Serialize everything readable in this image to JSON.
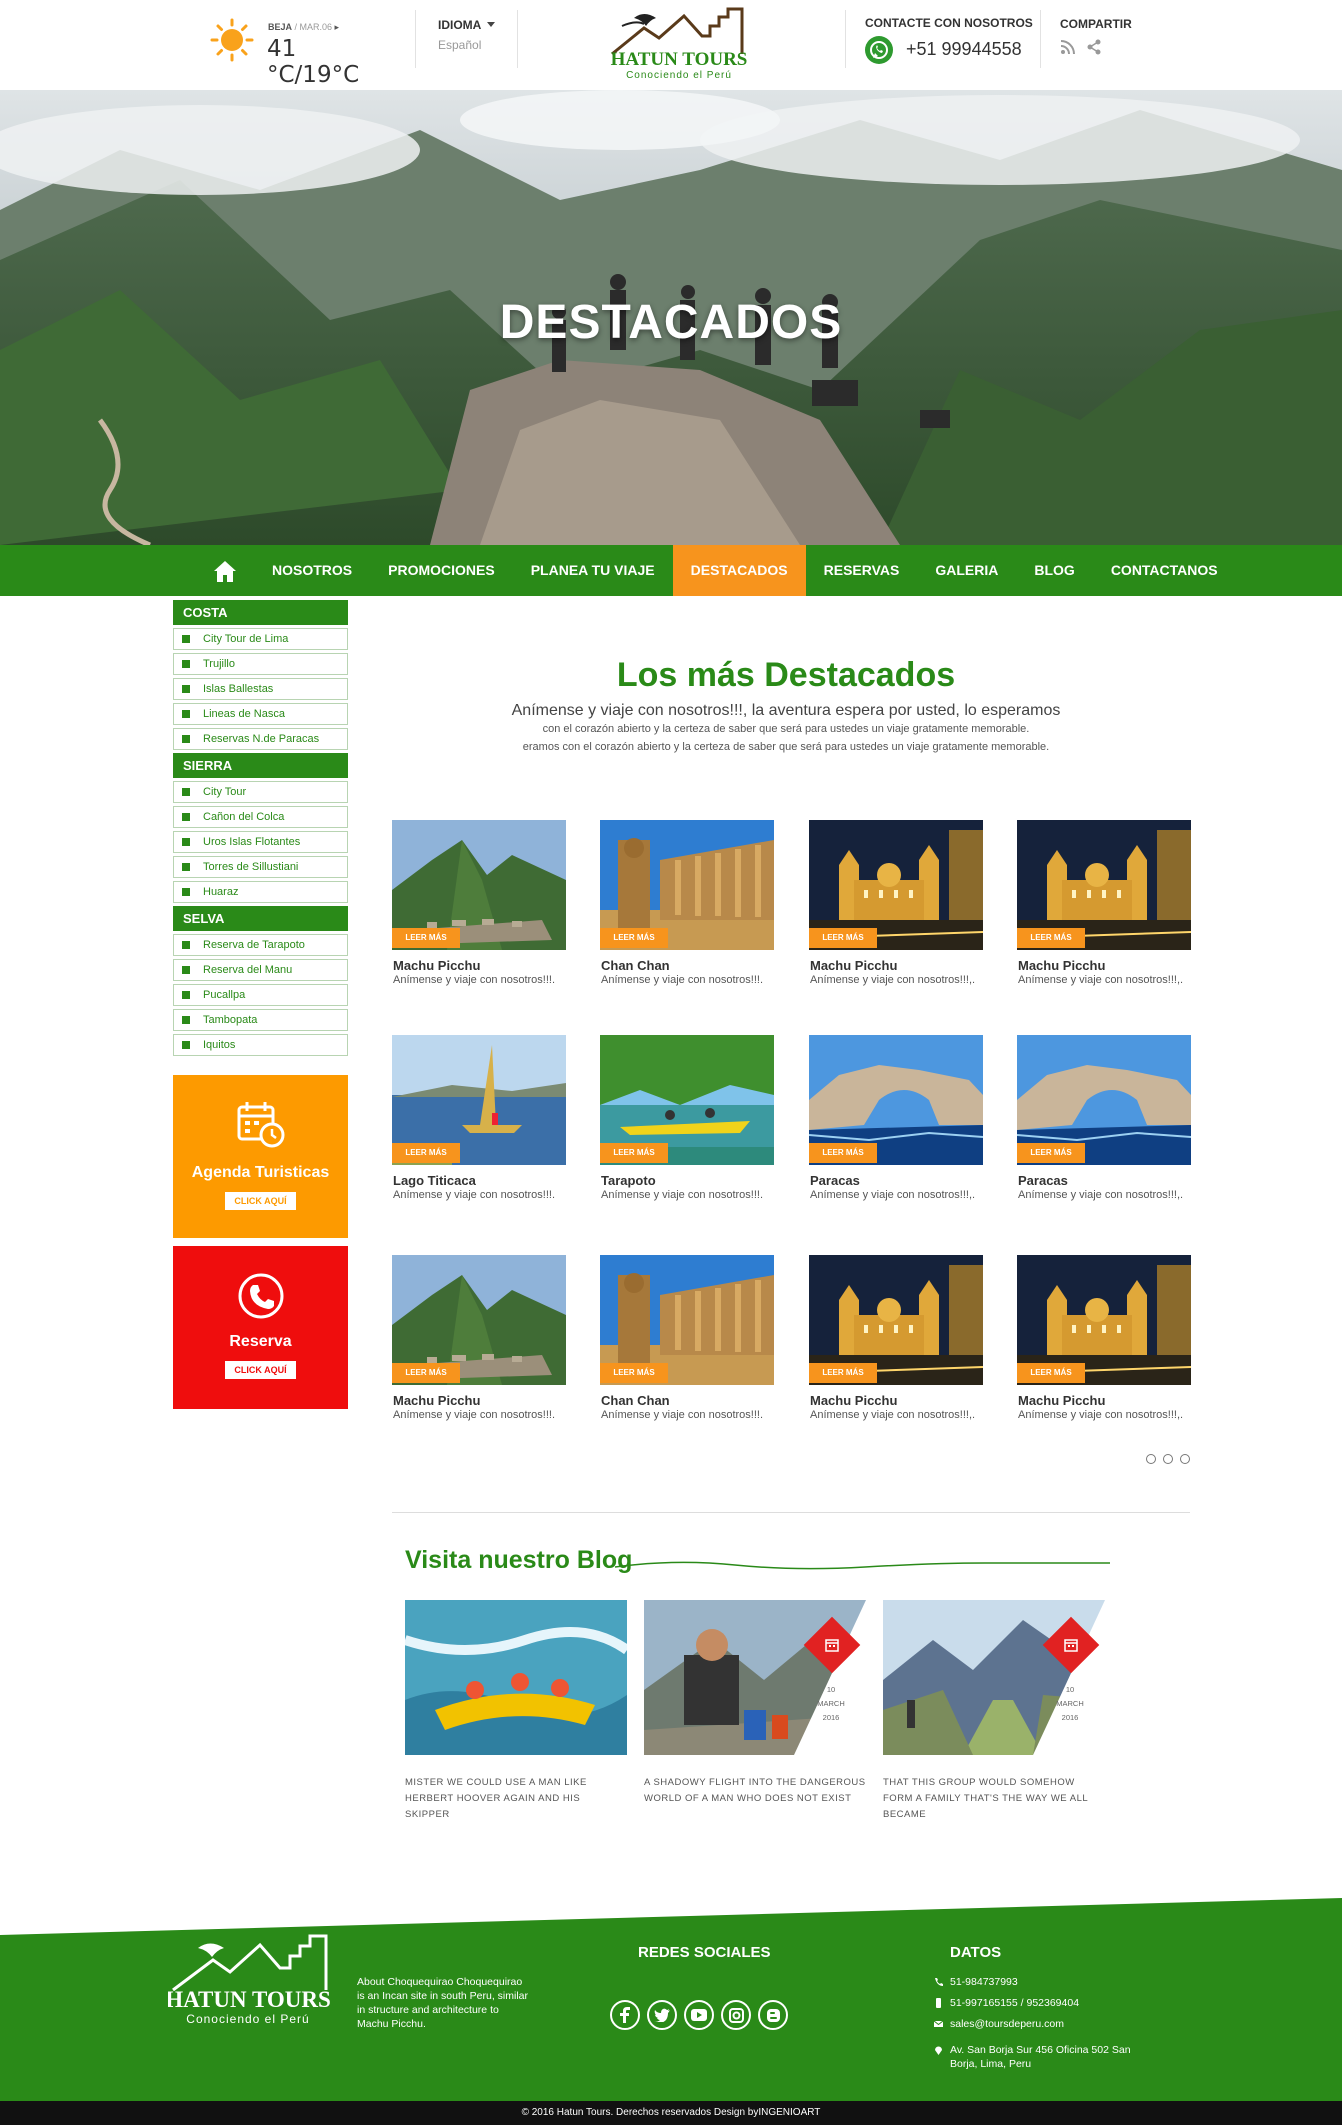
{
  "topbar": {
    "weather": {
      "location": "BEJA",
      "date": "/ MAR.06",
      "temp": "41 °C/19°C",
      "icon": "sun-icon"
    },
    "language": {
      "label": "IDIOMA",
      "value": "Español"
    },
    "logo": {
      "name": "HATUN TOURS",
      "tagline": "Conociendo el Perú"
    },
    "contact": {
      "label": "CONTACTE CON NOSOTROS",
      "phone": "+51 99944558",
      "icon": "whatsapp-icon"
    },
    "share": {
      "label": "COMPARTIR",
      "icons": [
        "rss-icon",
        "share-icon"
      ]
    }
  },
  "hero": {
    "title": "DESTACADOS"
  },
  "nav": {
    "home_icon": "home-icon",
    "items": [
      {
        "label": "NOSOTROS"
      },
      {
        "label": "PROMOCIONES"
      },
      {
        "label": "PLANEA TU VIAJE"
      },
      {
        "label": "DESTACADOS"
      },
      {
        "label": "RESERVAS"
      },
      {
        "label": "GALERIA"
      },
      {
        "label": "BLOG"
      },
      {
        "label": "CONTACTANOS"
      }
    ],
    "active": "DESTACADOS"
  },
  "sidebar": {
    "categories": [
      {
        "title": "COSTA",
        "items": [
          "City Tour de Lima",
          "Trujillo",
          "Islas Ballestas",
          "Lineas de Nasca",
          "Reservas N.de Paracas"
        ]
      },
      {
        "title": "SIERRA",
        "items": [
          "City Tour",
          "Cañon del Colca",
          "Uros Islas Flotantes",
          "Torres de Sillustiani",
          "Huaraz"
        ]
      },
      {
        "title": "SELVA",
        "items": [
          "Reserva de Tarapoto",
          "Reserva del Manu",
          "Pucallpa",
          "Tambopata",
          "Iquitos"
        ]
      }
    ],
    "agenda": {
      "title": "Agenda Turisticas",
      "button": "CLICK AQUÍ",
      "icon": "calendar-clock-icon"
    },
    "reserva": {
      "title": "Reserva",
      "button": "CLICK AQUÍ",
      "icon": "phone-icon"
    }
  },
  "main": {
    "title": "Los más Destacados",
    "intro": "Anímense y viaje con nosotros!!!, la aventura espera por usted, lo esperamos",
    "sub1": "con el corazón abierto y la certeza de saber que será para ustedes un viaje gratamente memorable.",
    "sub2": "eramos con el corazón abierto y la certeza de saber que será para ustedes un viaje gratamente memorable.",
    "read_more": "LEER MÁS",
    "cards": [
      {
        "title": "Machu Picchu",
        "desc": "Anímense y viaje con nosotros!!!.",
        "scene": "machu"
      },
      {
        "title": "Chan Chan",
        "desc": "Anímense y viaje con nosotros!!!.",
        "scene": "chanchan"
      },
      {
        "title": "Machu Picchu",
        "desc": "Anímense y viaje con nosotros!!!,.",
        "scene": "cathedral"
      },
      {
        "title": "Machu Picchu",
        "desc": "Anímense y viaje con nosotros!!!,.",
        "scene": "cathedral"
      },
      {
        "title": "Lago Titicaca",
        "desc": "Anímense y viaje con nosotros!!!.",
        "scene": "lake"
      },
      {
        "title": "Tarapoto",
        "desc": "Anímense y viaje con nosotros!!!.",
        "scene": "river"
      },
      {
        "title": "Paracas",
        "desc": "Anímense y viaje con nosotros!!!,.",
        "scene": "arch"
      },
      {
        "title": "Paracas",
        "desc": "Anímense y viaje con nosotros!!!,.",
        "scene": "arch"
      },
      {
        "title": "Machu Picchu",
        "desc": "Anímense y viaje con nosotros!!!.",
        "scene": "machu"
      },
      {
        "title": "Chan Chan",
        "desc": "Anímense y viaje con nosotros!!!.",
        "scene": "chanchan"
      },
      {
        "title": "Machu Picchu",
        "desc": "Anímense y viaje con nosotros!!!,.",
        "scene": "cathedral"
      },
      {
        "title": "Machu Picchu",
        "desc": "Anímense y viaje con nosotros!!!,.",
        "scene": "cathedral"
      }
    ],
    "pagination": {
      "pages": 3
    }
  },
  "blog": {
    "title": "Visita nuestro Blog",
    "posts": [
      {
        "text": "MISTER WE COULD USE A MAN LIKE HERBERT HOOVER AGAIN AND HIS SKIPPER",
        "scene": "rafting"
      },
      {
        "text": "A SHADOWY FLIGHT INTO THE DANGEROUS WORLD OF A MAN WHO DOES NOT EXIST",
        "scene": "hiker",
        "day": "10",
        "month": "MARCH",
        "year": "2016"
      },
      {
        "text": "THAT THIS GROUP WOULD SOMEHOW FORM A FAMILY THAT'S THE WAY WE ALL BECAME",
        "scene": "valley",
        "day": "10",
        "month": "MARCH",
        "year": "2016"
      }
    ]
  },
  "footer": {
    "logo": {
      "name": "HATUN TOURS",
      "tagline": "Conociendo el Perú"
    },
    "about": "About Choquequirao Choquequirao is an Incan site in south Peru, similar in structure and architecture to Machu Picchu.",
    "social_title": "REDES SOCIALES",
    "social_icons": [
      "facebook-icon",
      "twitter-icon",
      "youtube-icon",
      "instagram-icon",
      "blogger-icon"
    ],
    "data_title": "DATOS",
    "phone1": "51-984737993",
    "phone2": "51-997165155 / 952369404",
    "email": "sales@toursdeperu.com",
    "address": "Av. San Borja Sur 456 Oficina 502 San Borja, Lima, Peru",
    "copyright": "© 2016  Hatun Tours. Derechos reservados Design byINGENIOART"
  },
  "colors": {
    "green": "#2a8a18",
    "orange": "#f7941d",
    "red": "#ef0d0d",
    "agenda_orange": "#fd9a00"
  }
}
